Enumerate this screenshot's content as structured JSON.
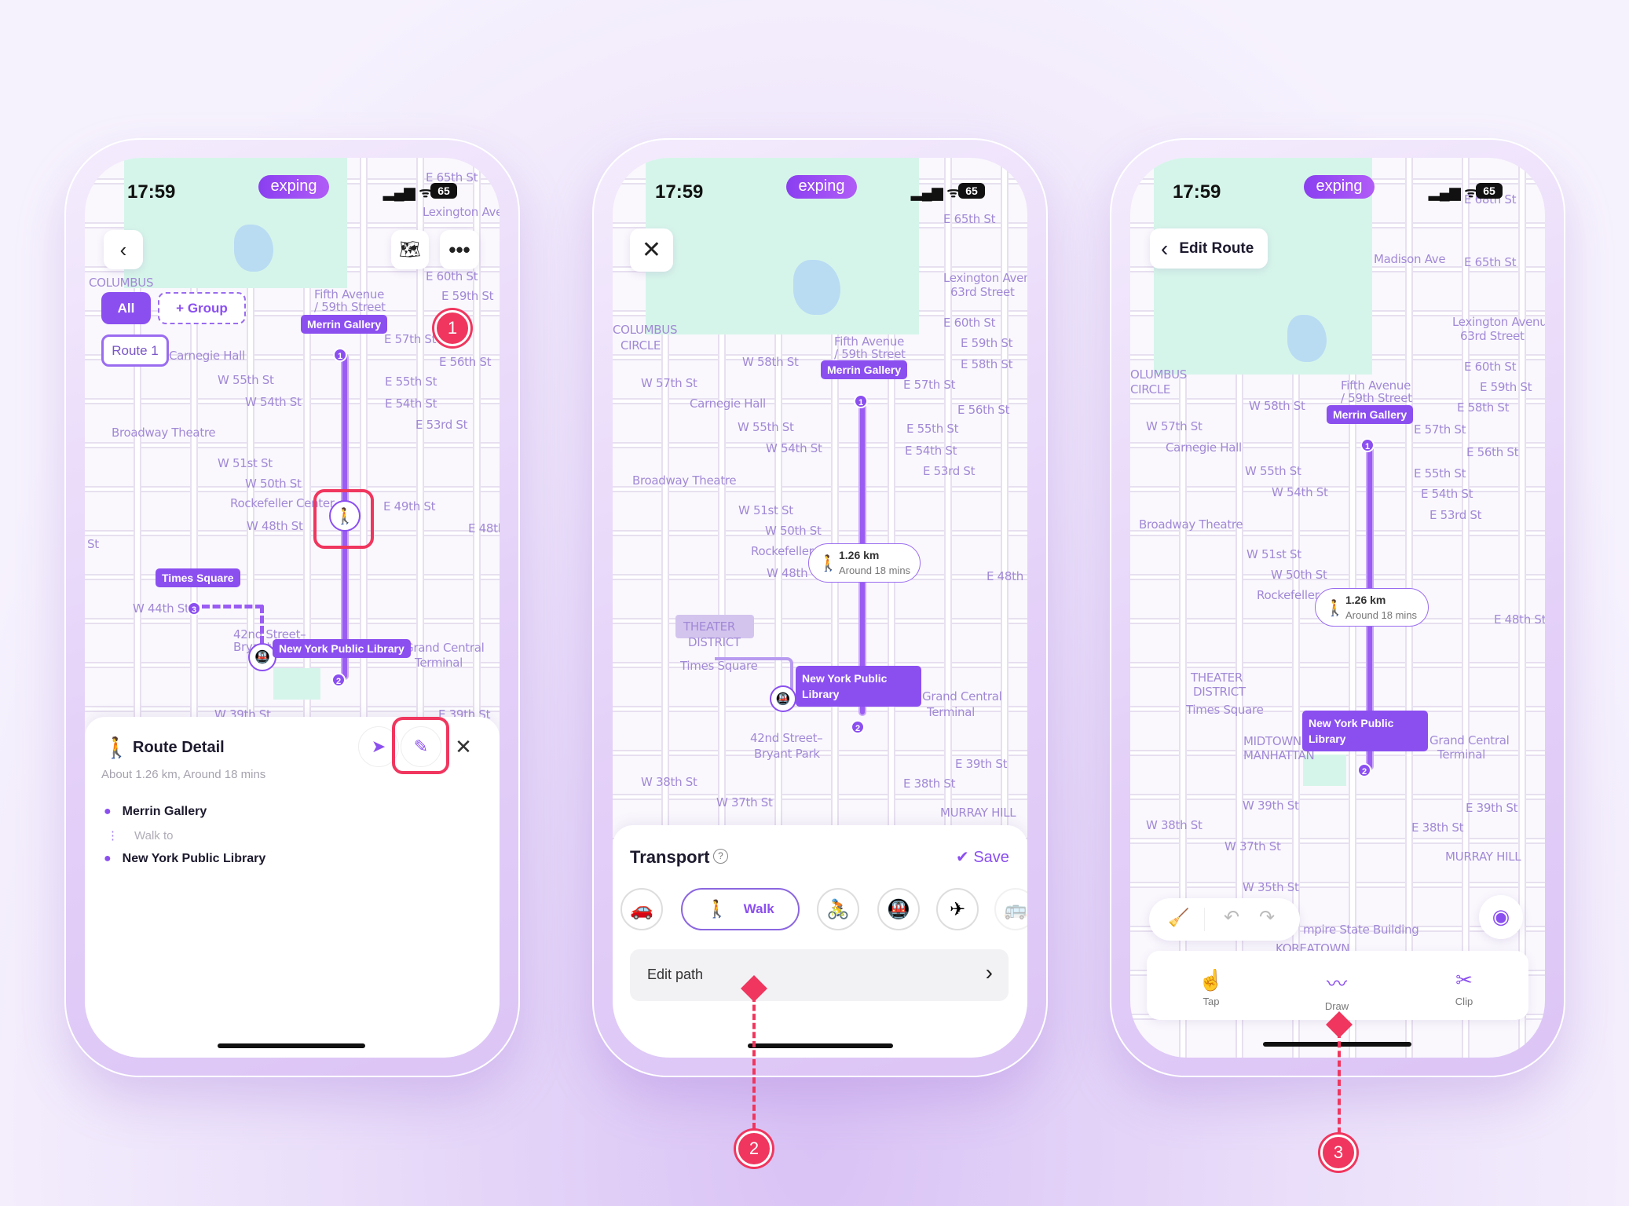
{
  "status_bar": {
    "time": "17:59",
    "battery": "65",
    "brand": "exping"
  },
  "colors": {
    "accent": "#8b4ff0",
    "callout": "#f0365e",
    "park": "#d6f5ea",
    "background": "#efe6fb"
  },
  "phone1": {
    "filters": {
      "all": "All",
      "group": "+ Group",
      "route": "Route 1"
    },
    "map_labels": [
      "E 65th St",
      "COLUMBUS",
      "Fifth Avenue",
      "/ 59th Street",
      "E 60th St",
      "E 59th St",
      "E 57th St",
      "E 56th St",
      "Carnegie Hall",
      "W 55th St",
      "E 55th St",
      "W 54th St",
      "E 54th St",
      "E 53rd St",
      "Broadway Theatre",
      "W 51st St",
      "W 50th St",
      "Rockefeller Center",
      "E 49th St",
      "W 48th St",
      "E 48th",
      "St",
      "W 44th St",
      "42nd Street–",
      "Bryant",
      "Grand Central",
      "Terminal",
      "W 39th St",
      "E 39th St",
      "Lexington Ave"
    ],
    "pins": {
      "start": "Merrin Gallery",
      "end": "New York Public Library",
      "extra": "Times Square",
      "m1": "1",
      "m2": "2",
      "m3": "3"
    },
    "icons": {
      "back": "chevron-left-icon",
      "map": "map-icon",
      "more": "more-icon",
      "walk": "walk-icon",
      "subway": "subway-icon"
    },
    "sheet": {
      "title": "Route Detail",
      "subtitle": "About 1.26 km, Around 18 mins",
      "stops": [
        {
          "name": "Merrin Gallery"
        },
        {
          "name": "Walk to"
        },
        {
          "name": "New York Public Library"
        }
      ]
    }
  },
  "phone2": {
    "map_labels": [
      "COLUMBUS",
      "CIRCLE",
      "Fifth Avenue",
      "/ 59th Street",
      "E 65th St",
      "Lexington Aven",
      "63rd Street",
      "E 60th St",
      "E 59th St",
      "W 58th St",
      "E 58th St",
      "W 57th St",
      "E 57th St",
      "Carnegie Hall",
      "E 56th St",
      "W 55th St",
      "E 55th St",
      "W 54th St",
      "E 54th St",
      "E 53rd St",
      "Broadway Theatre",
      "W 51st St",
      "W 50th St",
      "Rockefeller",
      "W 48th",
      "E 48th St",
      "THEATER",
      "DISTRICT",
      "Times Square",
      "42nd Street–",
      "Bryant Park",
      "Grand Central",
      "Terminal",
      "W 38th St",
      "E 38th St",
      "E 39th St",
      "W 37th St",
      "MURRAY HILL"
    ],
    "pins": {
      "start": "Merrin Gallery",
      "end": "New York Public Library",
      "m1": "1",
      "m2": "2",
      "distance": "1.26 km",
      "duration": "Around 18 mins"
    },
    "sheet": {
      "title": "Transport",
      "save": "Save",
      "modes": [
        {
          "icon": "car-icon"
        },
        {
          "icon": "walk-icon",
          "label": "Walk",
          "selected": true
        },
        {
          "icon": "bike-icon"
        },
        {
          "icon": "subway-icon"
        },
        {
          "icon": "plane-icon"
        },
        {
          "icon": "bus-icon"
        }
      ],
      "edit_path": "Edit path"
    }
  },
  "phone3": {
    "header": "Edit Route",
    "map_labels": [
      "OLUMBUS",
      "CIRCLE",
      "Fifth Avenue",
      "/ 59th Street",
      "E 65th St",
      "Lexington Avenu",
      "63rd Street",
      "E 60th St",
      "E 59th St",
      "W 58th St",
      "E 58th St",
      "W 57th St",
      "E 57th St",
      "Carnegie Hall",
      "E 56th St",
      "W 55th St",
      "E 55th St",
      "W 54th St",
      "E 54th St",
      "E 53rd St",
      "Broadway Theatre",
      "W 51st St",
      "W 50th St",
      "Rockefeller",
      "E 48th St",
      "THEATER",
      "DISTRICT",
      "Times Square",
      "MIDTOWN",
      "MANHATTAN",
      "Grand Central",
      "Terminal",
      "W 39th St",
      "E 39th St",
      "W 38th St",
      "E 38th St",
      "W 37th St",
      "MURRAY HILL",
      "W 35th St",
      "mpire State Building",
      "KOREATOWN",
      "E 68th St",
      "Madison Ave"
    ],
    "pins": {
      "start": "Merrin Gallery",
      "end": "New York Public Library",
      "m1": "1",
      "m2": "2",
      "distance": "1.26 km",
      "duration": "Around 18 mins"
    },
    "tools": [
      {
        "label": "Tap",
        "icon": "tap-icon"
      },
      {
        "label": "Draw",
        "icon": "draw-icon"
      },
      {
        "label": "Clip",
        "icon": "scissors-icon"
      }
    ]
  },
  "callouts": [
    "1",
    "2",
    "3"
  ]
}
